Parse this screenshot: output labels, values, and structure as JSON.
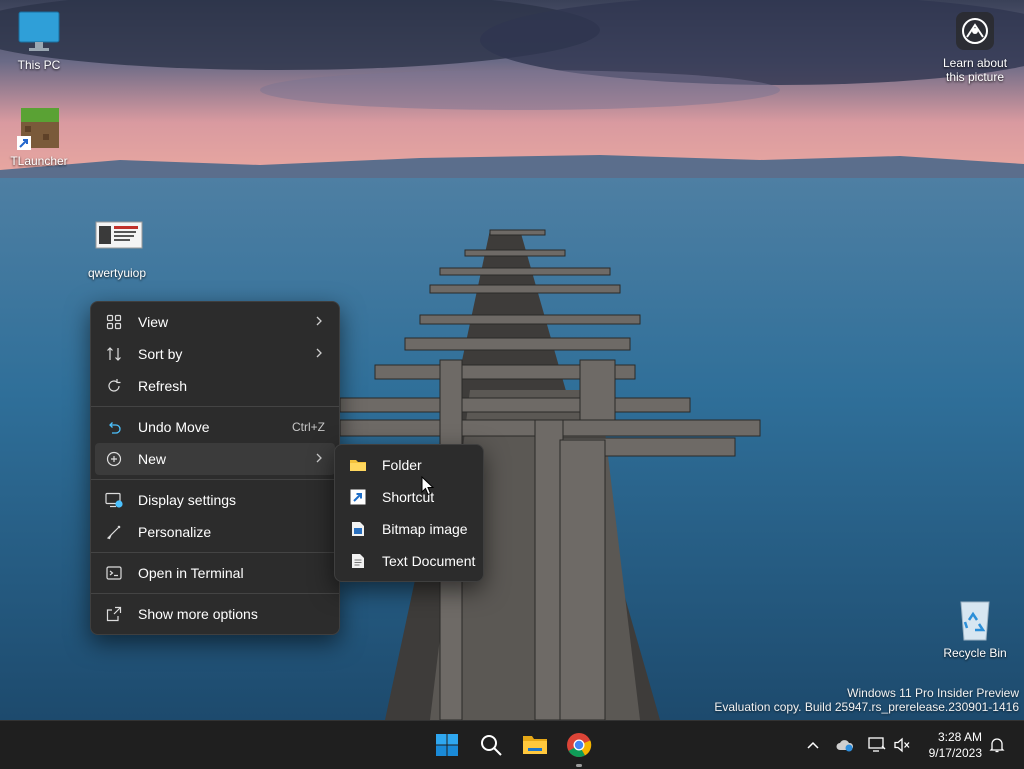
{
  "desktop": {
    "icons": [
      {
        "label": "This PC"
      },
      {
        "label": "TLauncher"
      },
      {
        "label": "qwertyuiop"
      },
      {
        "label": "Recycle Bin"
      }
    ],
    "learn_about": "Learn about this picture",
    "watermark": {
      "line1": "Windows 11 Pro Insider Preview",
      "line2": "Evaluation copy. Build 25947.rs_prerelease.230901-1416"
    }
  },
  "context_menu": {
    "items": [
      {
        "label": "View",
        "icon": "grid-icon",
        "has_submenu": true
      },
      {
        "label": "Sort by",
        "icon": "sort-icon",
        "has_submenu": true
      },
      {
        "label": "Refresh",
        "icon": "refresh-icon"
      },
      {
        "label": "Undo Move",
        "icon": "undo-icon",
        "shortcut": "Ctrl+Z"
      },
      {
        "label": "New",
        "icon": "plus-circle-icon",
        "has_submenu": true
      },
      {
        "label": "Display settings",
        "icon": "display-icon"
      },
      {
        "label": "Personalize",
        "icon": "brush-icon"
      },
      {
        "label": "Open in Terminal",
        "icon": "terminal-icon"
      },
      {
        "label": "Show more options",
        "icon": "share-icon"
      }
    ]
  },
  "new_submenu": {
    "items": [
      {
        "label": "Folder",
        "icon": "folder-icon"
      },
      {
        "label": "Shortcut",
        "icon": "shortcut-icon"
      },
      {
        "label": "Bitmap image",
        "icon": "bitmap-icon"
      },
      {
        "label": "Text Document",
        "icon": "text-document-icon"
      }
    ]
  },
  "taskbar": {
    "apps": [
      "start-icon",
      "search-icon",
      "file-explorer-icon",
      "chrome-icon"
    ],
    "clock": {
      "time": "3:28 AM",
      "date": "9/17/2023"
    }
  },
  "colors": {
    "menu_bg": "#2c2c2c",
    "taskbar_bg": "#1f1f1f",
    "accent": "#4cc2ff"
  }
}
